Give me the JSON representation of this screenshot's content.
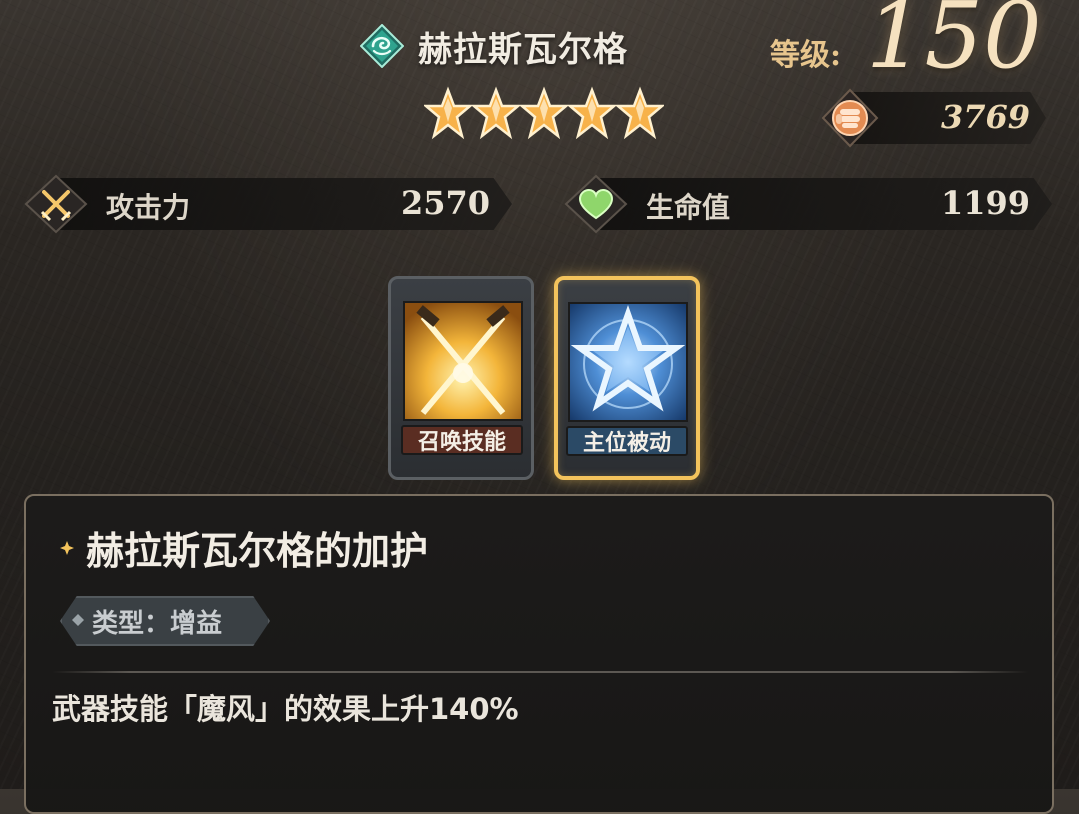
{
  "hero": {
    "name": "赫拉斯瓦尔格",
    "element_icon": "wind-element-icon",
    "stars": 5,
    "level_label": "等级:",
    "level": "150",
    "power_icon": "fist-icon",
    "power": "3769"
  },
  "stats": [
    {
      "icon": "crossed-swords-icon",
      "label": "攻击力",
      "value": "2570"
    },
    {
      "icon": "heart-icon",
      "label": "生命值",
      "value": "1199"
    }
  ],
  "skills": [
    {
      "label": "召唤技能",
      "icon": "crossed-swords-skill-icon",
      "selected": false,
      "tag_color": "#5a2d22"
    },
    {
      "label": "主位被动",
      "icon": "star-skill-icon",
      "selected": true,
      "tag_color": "#2b4a66"
    }
  ],
  "detail": {
    "title": "赫拉斯瓦尔格的加护",
    "type_text": "类型：增益",
    "description": "武器技能「魔风」的效果上升140%"
  },
  "colors": {
    "gold_accent": "#f3c35c",
    "star_gold": "#f7b24a",
    "heart_green": "#8fd66b",
    "power_orange": "#e38b52"
  }
}
